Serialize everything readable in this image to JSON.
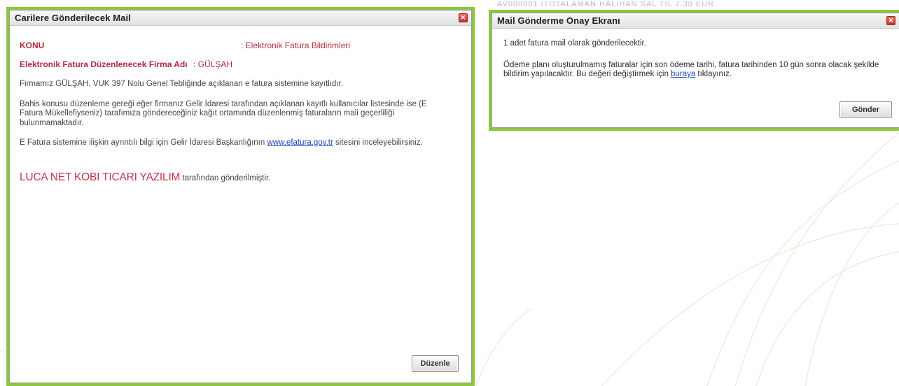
{
  "left_window": {
    "title": "Carilere Gönderilecek Mail",
    "close_glyph": "✕",
    "subject_label": "KONU",
    "subject_value": ": Elektronik Fatura Bildirimleri",
    "company_label": "Elektronik Fatura Düzenlenecek Firma Adı",
    "company_value": ": GÜLŞAH",
    "para1": "Firmamız GÜLŞAH, VUK 397 Nolu Genel Tebliğinde açıklanan e fatura sistemine kayıtlıdır.",
    "para2": "Bahis konusu düzenleme gereği eğer firmanız Gelir İdaresi tarafından açıklanan kayıtlı kullanıcılar listesinde ise (E Fatura Mükellefiyseniz) tarafımıza göndereceğiniz kağıt ortamında düzenlenmiş faturaların mali geçerliliği bulunmamaktadır.",
    "para3_prefix": "E Fatura sistemine ilişkin ayrıntılı bilgi için Gelir İdaresi Başkanlığının ",
    "para3_link": "www.efatura.gov.tr",
    "para3_suffix": " sitesini inceleyebilirsiniz.",
    "brand": "LUCA NET KOBI TICARI YAZILIM",
    "sent_by_suffix": " tarafından gönderilmiştir.",
    "edit_button": "Düzenle"
  },
  "right_window": {
    "top_strip": "AV000001        İTOTALAMAN HALİHAN SAL TİL        7.30  EUR",
    "title": "Mail Gönderme Onay Ekranı",
    "close_glyph": "✕",
    "line1": "1 adet fatura mail olarak gönderilecektir.",
    "line2_prefix": "Ödeme planı oluşturulmamış faturalar için son ödeme tarihi, fatura tarihinden 10 gün sonra olacak şekilde bildirim yapılacaktır. Bu değeri değiştirmek için ",
    "line2_link": "buraya",
    "line2_suffix": " tıklayınız.",
    "send_button": "Gönder"
  },
  "colors": {
    "frame_green": "#8dc63f",
    "label_red": "#b22b3e",
    "link_blue": "#1f46b8"
  }
}
